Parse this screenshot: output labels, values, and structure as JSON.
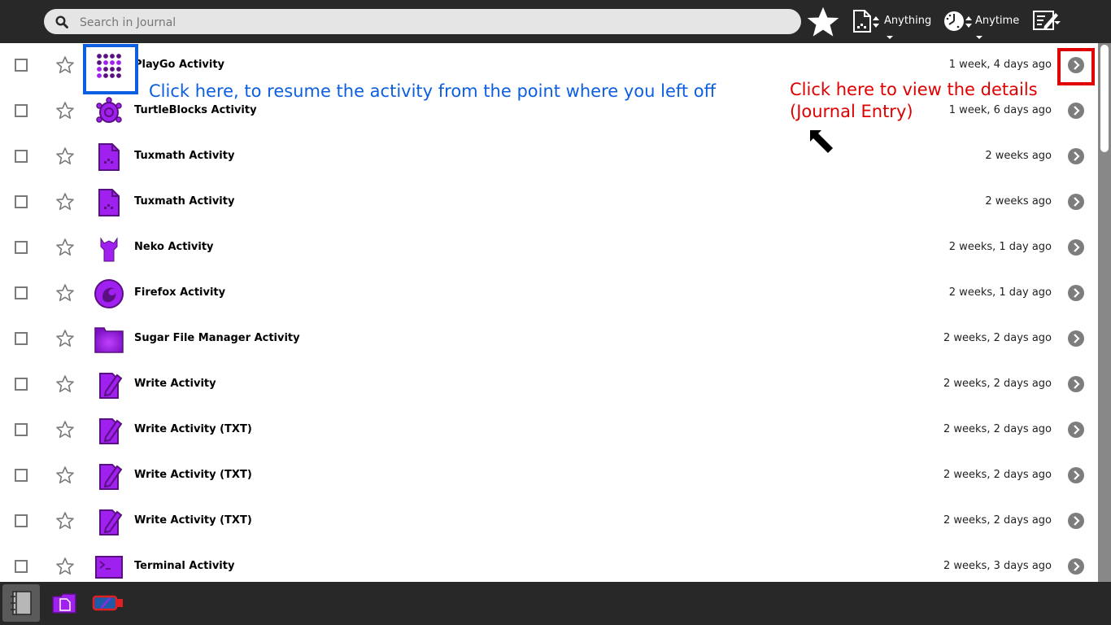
{
  "toolbar": {
    "search_placeholder": "Search in Journal",
    "filter_type_label": "Anything",
    "filter_time_label": "Anytime"
  },
  "entries": [
    {
      "title": "PlayGo Activity",
      "time": "1 week, 4 days ago",
      "icon": "playgo-icon"
    },
    {
      "title": "TurtleBlocks Activity",
      "time": "1 week, 6 days ago",
      "icon": "turtle-icon"
    },
    {
      "title": "Tuxmath Activity",
      "time": "2 weeks ago",
      "icon": "document-icon"
    },
    {
      "title": "Tuxmath Activity",
      "time": "2 weeks ago",
      "icon": "document-icon"
    },
    {
      "title": "Neko Activity",
      "time": "2 weeks, 1 day ago",
      "icon": "cat-icon"
    },
    {
      "title": "Firefox Activity",
      "time": "2 weeks, 1 day ago",
      "icon": "firefox-icon"
    },
    {
      "title": "Sugar File Manager Activity",
      "time": "2 weeks, 2 days ago",
      "icon": "folder-icon"
    },
    {
      "title": "Write Activity",
      "time": "2 weeks, 2 days ago",
      "icon": "write-icon"
    },
    {
      "title": "Write Activity (TXT)",
      "time": "2 weeks, 2 days ago",
      "icon": "write-icon"
    },
    {
      "title": "Write Activity (TXT)",
      "time": "2 weeks, 2 days ago",
      "icon": "write-icon"
    },
    {
      "title": "Write Activity (TXT)",
      "time": "2 weeks, 2 days ago",
      "icon": "write-icon"
    },
    {
      "title": "Terminal Activity",
      "time": "2 weeks, 3 days ago",
      "icon": "terminal-icon"
    }
  ],
  "annotations": {
    "resume_note": "Click here, to resume the activity from the point where you left off",
    "details_note_line1": "Click here to view the details",
    "details_note_line2": "(Journal Entry)"
  },
  "colors": {
    "toolbar_bg": "#282828",
    "activity_purple": "#a020f0",
    "activity_stroke": "#5a1080",
    "annotation_blue": "#0b5fe0",
    "annotation_red": "#e00000"
  }
}
